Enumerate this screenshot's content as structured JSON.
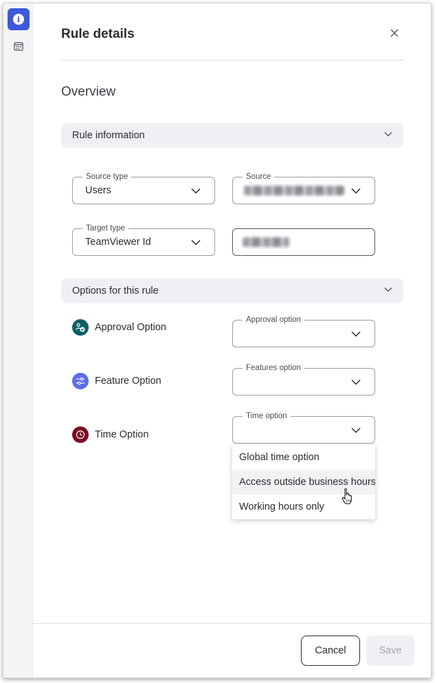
{
  "panel": {
    "title": "Rule details"
  },
  "overview": {
    "heading": "Overview"
  },
  "rule_information": {
    "section_label": "Rule information",
    "source_type": {
      "label": "Source type",
      "value": "Users"
    },
    "source": {
      "label": "Source",
      "value": ""
    },
    "target_type": {
      "label": "Target type",
      "value": "TeamViewer Id"
    },
    "target_value": {
      "value": ""
    }
  },
  "options": {
    "section_label": "Options for this rule",
    "approval": {
      "label": "Approval Option",
      "field_label": "Approval option",
      "value": "",
      "icon": "approval-icon",
      "color": "#0f5f63"
    },
    "feature": {
      "label": "Feature Option",
      "field_label": "Features option",
      "value": "",
      "icon": "sliders-icon",
      "color": "#5b6ee8"
    },
    "time": {
      "label": "Time Option",
      "field_label": "Time option",
      "value": "",
      "icon": "clock-icon",
      "color": "#7a0e22"
    }
  },
  "time_dropdown": {
    "items": [
      {
        "label": "Global time option"
      },
      {
        "label": "Access outside business hours"
      },
      {
        "label": "Working hours only"
      }
    ]
  },
  "footer": {
    "cancel_label": "Cancel",
    "save_label": "Save"
  },
  "colors": {
    "accent": "#3c59d8",
    "section_bg": "#f0f0f4"
  }
}
